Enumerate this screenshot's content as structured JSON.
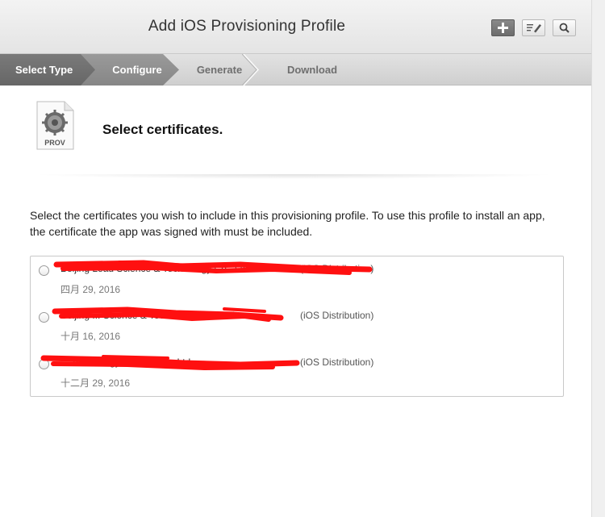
{
  "header": {
    "title": "Add iOS Provisioning Profile",
    "buttons": [
      {
        "name": "add-button",
        "icon": "plus-icon"
      },
      {
        "name": "edit-button",
        "icon": "edit-icon"
      },
      {
        "name": "search-button",
        "icon": "search-icon"
      }
    ]
  },
  "steps": [
    "Select Type",
    "Configure",
    "Generate",
    "Download"
  ],
  "current_step": "Configure",
  "icon_label": "PROV",
  "heading": "Select certificates.",
  "description": "Select the certificates you wish to include in this provisioning profile. To use this profile to install an app, the certificate the app was signed with must be included.",
  "certificates": [
    {
      "name": "Beijing Leau Science & Technology Co., Ltd.",
      "type": "(iOS Distribution)",
      "date": "四月 29, 2016"
    },
    {
      "name": "Beijing ... Science & Technology Co., Ltd.",
      "type": "(iOS Distribution)",
      "date": "十月 16, 2016"
    },
    {
      "name": "... Technology Culture Co., Ltd.",
      "type": "(iOS Distribution)",
      "date": "十二月 29, 2016"
    }
  ],
  "colors": {
    "redaction": "#ff0000",
    "step_active": "#6b6b6b",
    "step_done": "#8c8c8c"
  }
}
